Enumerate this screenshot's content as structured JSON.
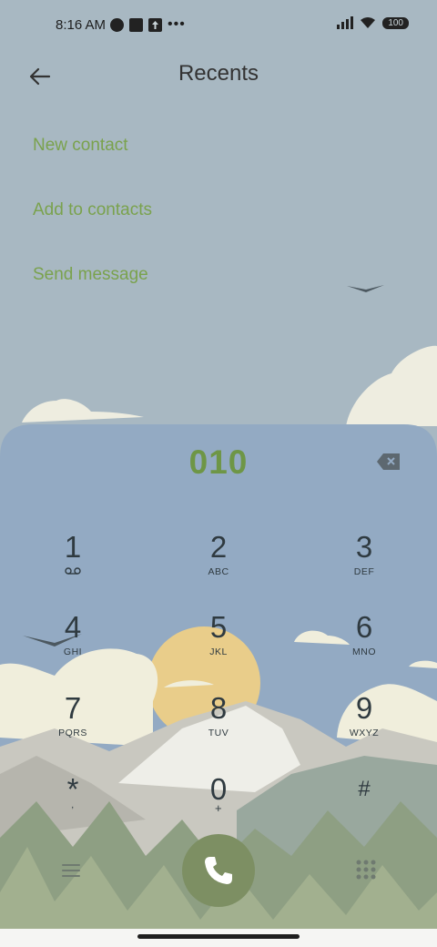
{
  "status_bar": {
    "time": "8:16 AM",
    "battery": "100",
    "left_icons": [
      "data-saver-icon",
      "notification-square-icon",
      "upload-icon",
      "more-dots-icon"
    ],
    "right_icons": [
      "signal-icon",
      "wifi-icon",
      "battery-icon"
    ]
  },
  "header": {
    "title": "Recents",
    "back_icon": "arrow-left-icon"
  },
  "menu": {
    "items": [
      {
        "label": "New contact"
      },
      {
        "label": "Add to contacts"
      },
      {
        "label": "Send message"
      }
    ]
  },
  "dialer": {
    "number": "010",
    "keys": [
      {
        "digit": "1",
        "letters": "ᴼᴼ"
      },
      {
        "digit": "2",
        "letters": "ABC"
      },
      {
        "digit": "3",
        "letters": "DEF"
      },
      {
        "digit": "4",
        "letters": "GHI"
      },
      {
        "digit": "5",
        "letters": "JKL"
      },
      {
        "digit": "6",
        "letters": "MNO"
      },
      {
        "digit": "7",
        "letters": "PQRS"
      },
      {
        "digit": "8",
        "letters": "TUV"
      },
      {
        "digit": "9",
        "letters": "WXYZ"
      },
      {
        "digit": "*",
        "letters": ","
      },
      {
        "digit": "0",
        "letters": "+"
      },
      {
        "digit": "#",
        "letters": ""
      }
    ]
  },
  "colors": {
    "accent_green": "#7aa24d",
    "call_button": "#7d8f63",
    "sky": "#a8b8c2"
  }
}
